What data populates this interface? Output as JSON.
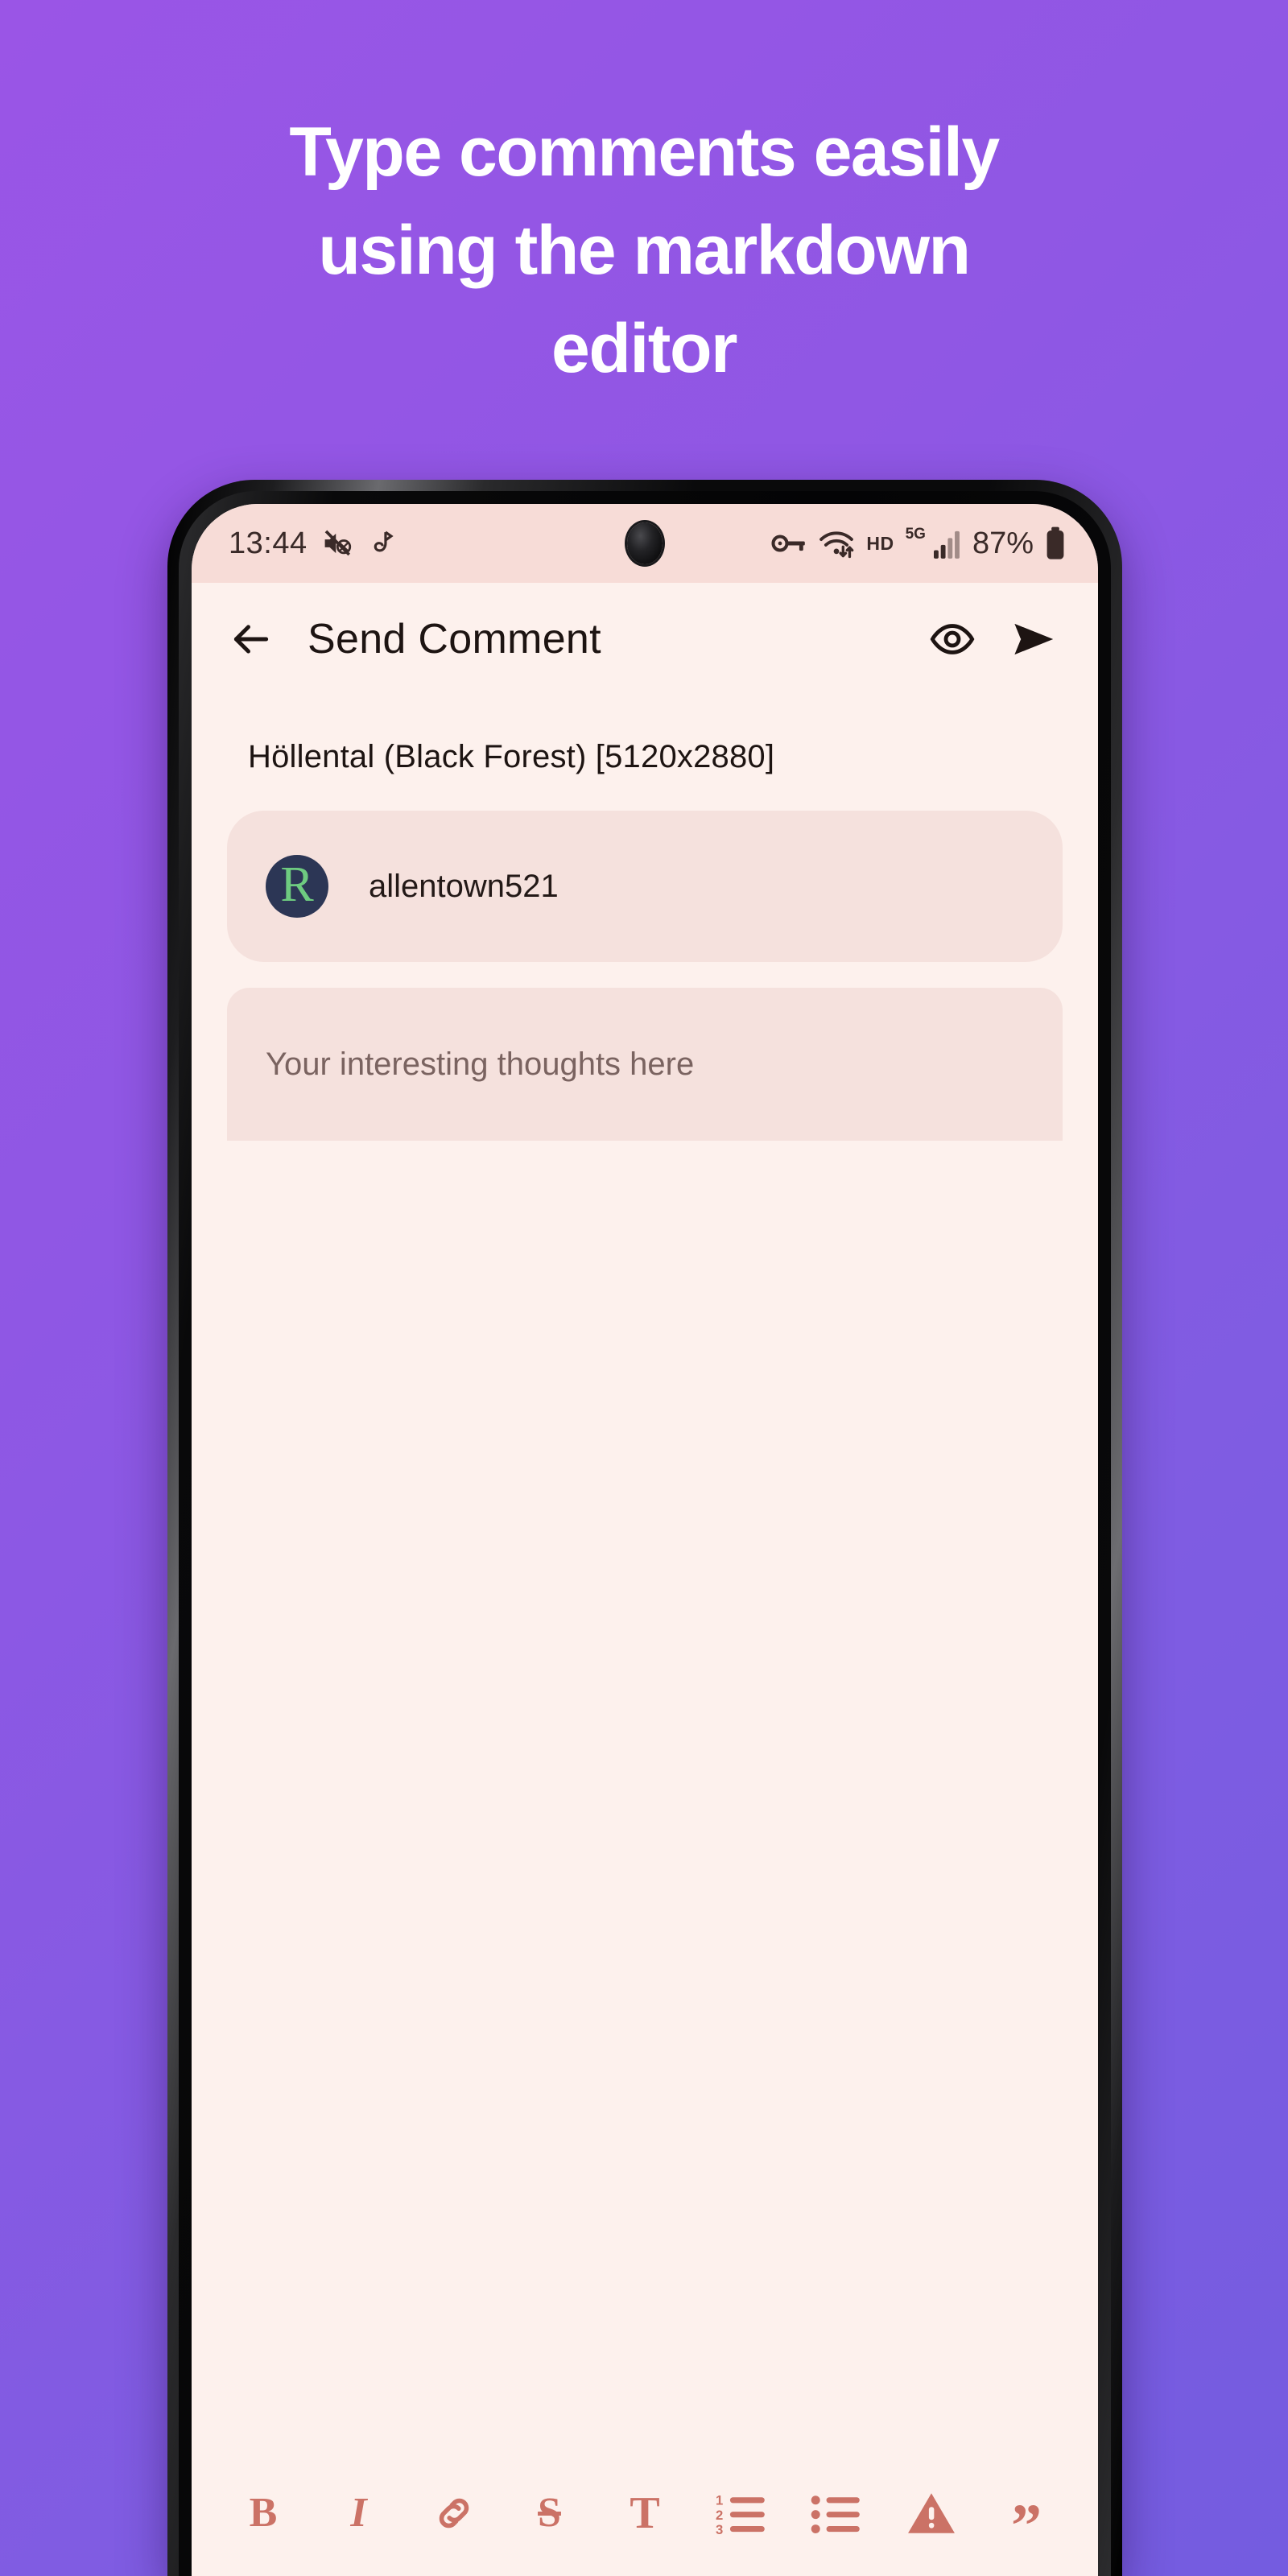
{
  "promo": {
    "headline_lines": [
      "Type comments easily",
      "using the markdown",
      "editor"
    ],
    "background_from": "#9a55e6",
    "background_to": "#745ce0",
    "headline_color": "#ffffff"
  },
  "status_bar": {
    "time": "13:44",
    "icons_left": [
      "mute-volume-icon",
      "bluetooth-audio-icon"
    ],
    "vpn_icon": "vpn-key-icon",
    "wifi_icon": "wifi-transfer-icon",
    "hd_label": "HD",
    "network_label": "5G",
    "signal_icon": "signal-bars-icon",
    "battery_percent": "87%",
    "battery_icon": "battery-full-icon"
  },
  "app_bar": {
    "back_icon": "back-arrow-icon",
    "title": "Send Comment",
    "preview_icon": "eye-preview-icon",
    "send_icon": "send-paper-plane-icon"
  },
  "post": {
    "title": "Höllental (Black Forest) [5120x2880]"
  },
  "username_field": {
    "avatar_letter": "R",
    "avatar_bg": "#2c3655",
    "avatar_fg": "#6ecb80",
    "value": "allentown521"
  },
  "comment_field": {
    "placeholder": "Your interesting thoughts here",
    "value": ""
  },
  "markdown_toolbar": {
    "accent_color": "#cb7266",
    "items": [
      {
        "name": "bold",
        "glyph": "B",
        "label": "Bold"
      },
      {
        "name": "italic",
        "glyph": "I",
        "label": "Italic"
      },
      {
        "name": "link",
        "glyph": "",
        "label": "Link"
      },
      {
        "name": "strikethrough",
        "glyph": "S",
        "label": "Strikethrough"
      },
      {
        "name": "heading",
        "glyph": "T",
        "label": "Heading"
      },
      {
        "name": "numbered-list",
        "glyph": "",
        "label": "Numbered list"
      },
      {
        "name": "bullet-list",
        "glyph": "",
        "label": "Bullet list"
      },
      {
        "name": "spoiler",
        "glyph": "",
        "label": "Spoiler"
      },
      {
        "name": "quote",
        "glyph": "”",
        "label": "Quote"
      }
    ],
    "numbered_labels": [
      "1",
      "2",
      "3"
    ]
  },
  "device": {
    "frame_color": "#0a0a0b",
    "screen_bg": "#fdf1ed",
    "status_bg": "#f7dcd7",
    "field_bg": "#f5e1dd"
  }
}
